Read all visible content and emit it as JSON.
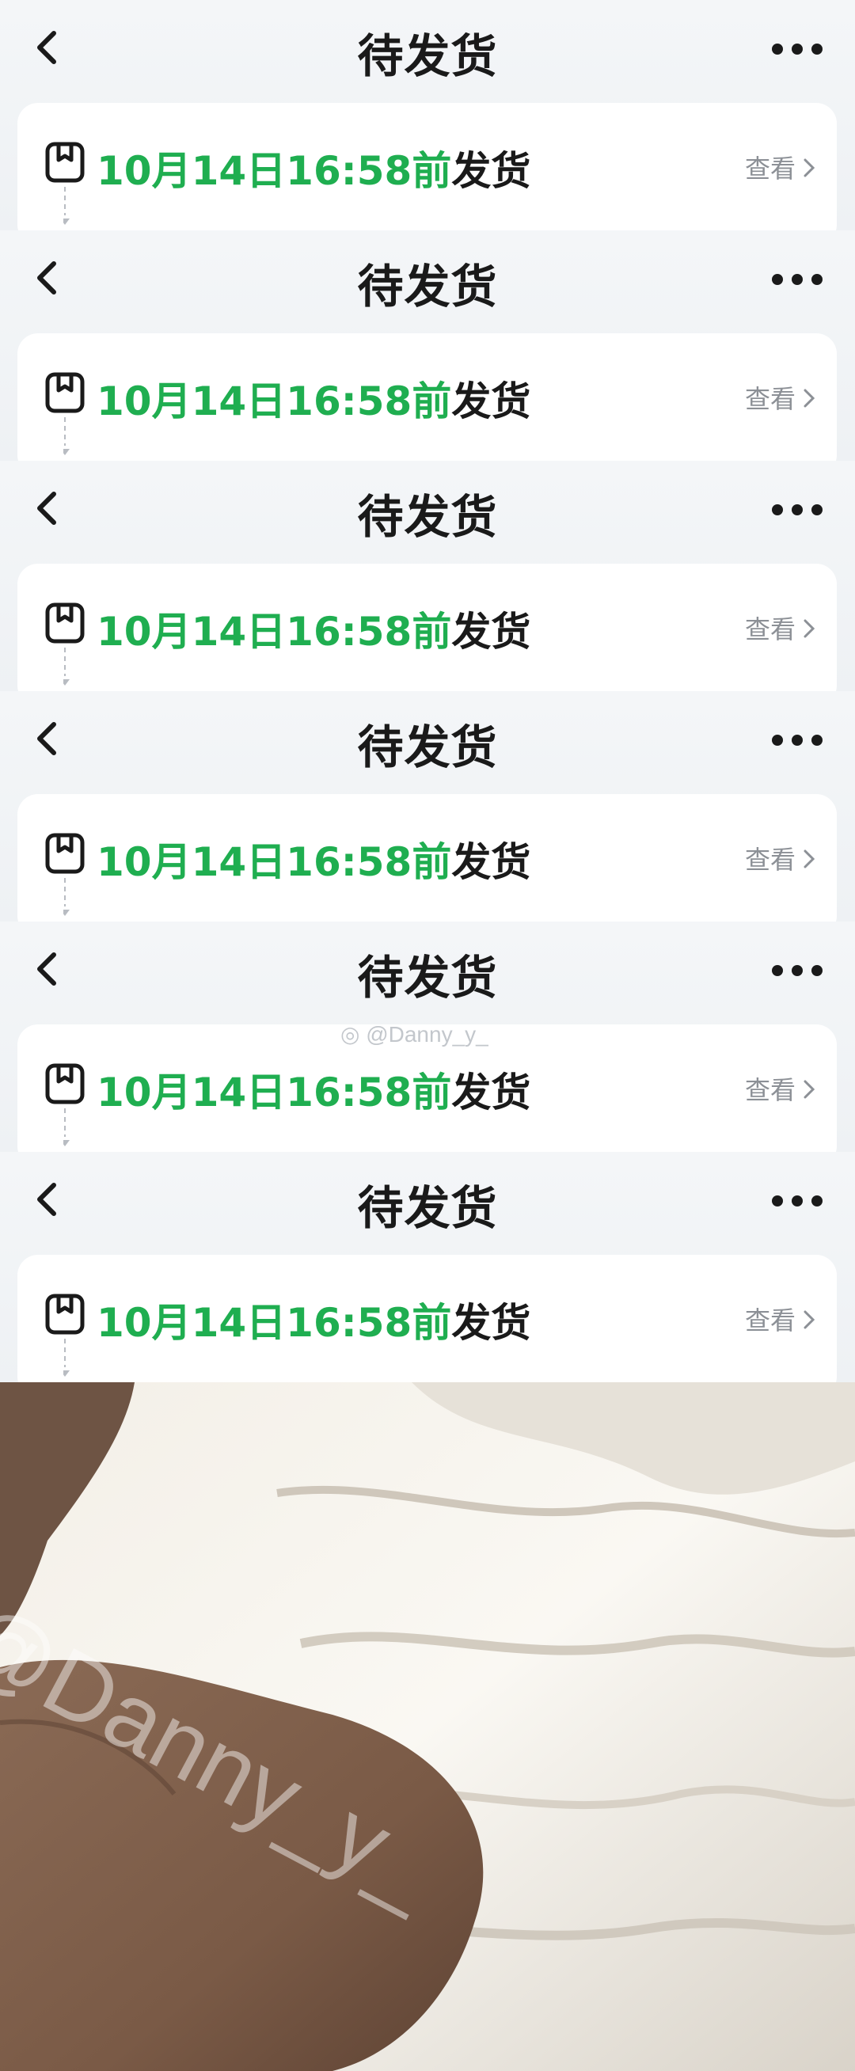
{
  "screenshots": [
    {
      "title": "待发货",
      "deadline_green": "10月14日16:58前",
      "deadline_suffix": "发货",
      "view_label": "查看"
    },
    {
      "title": "待发货",
      "deadline_green": "10月14日16:58前",
      "deadline_suffix": "发货",
      "view_label": "查看"
    },
    {
      "title": "待发货",
      "deadline_green": "10月14日16:58前",
      "deadline_suffix": "发货",
      "view_label": "查看"
    },
    {
      "title": "待发货",
      "deadline_green": "10月14日16:58前",
      "deadline_suffix": "发货",
      "view_label": "查看"
    },
    {
      "title": "待发货",
      "deadline_green": "10月14日16:58前",
      "deadline_suffix": "发货",
      "view_label": "查看"
    },
    {
      "title": "待发货",
      "deadline_green": "10月14日16:58前",
      "deadline_suffix": "发货",
      "view_label": "查看"
    }
  ],
  "icons": {
    "back": "chevron-left-icon",
    "more": "more-dots-icon",
    "box": "package-box-icon",
    "chevron": "chevron-right-icon"
  },
  "colors": {
    "accent_green": "#1fae50",
    "title": "#1a1a1a",
    "muted": "#8c9096",
    "page_bg": "#eef1f4"
  },
  "watermark_small": "@Danny_y_",
  "watermark_photo": "@Danny_y_"
}
